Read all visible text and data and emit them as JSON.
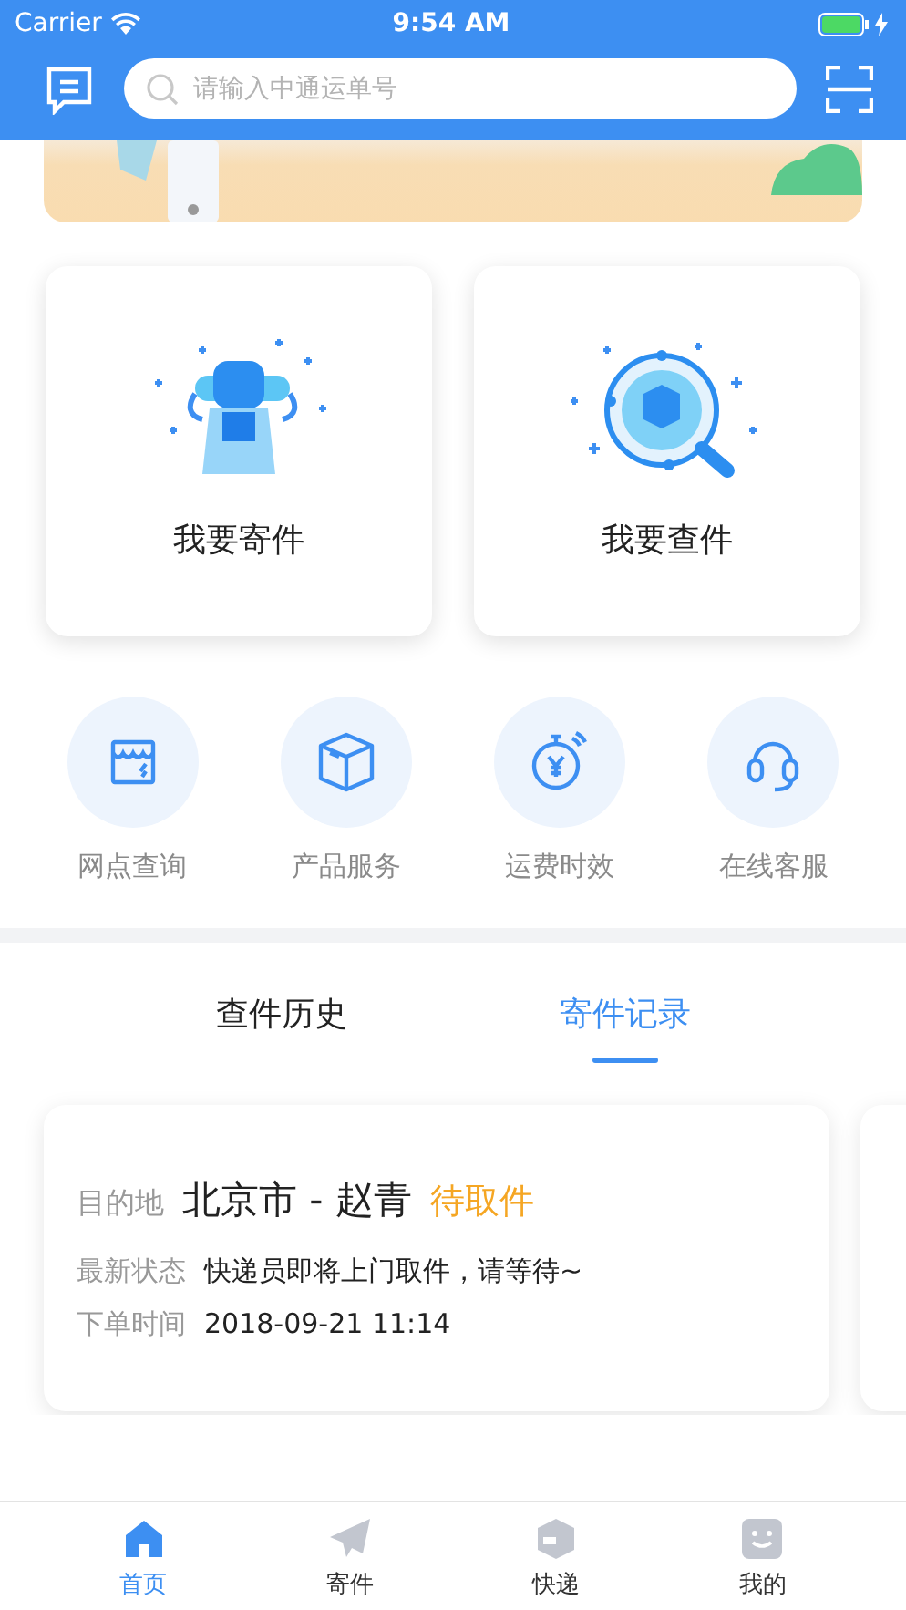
{
  "status_bar": {
    "carrier": "Carrier",
    "time": "9:54 AM"
  },
  "search": {
    "placeholder": "请输入中通运单号"
  },
  "actions": [
    {
      "label": "我要寄件",
      "kind": "send"
    },
    {
      "label": "我要查件",
      "kind": "track"
    }
  ],
  "services": [
    {
      "label": "网点查询",
      "kind": "store"
    },
    {
      "label": "产品服务",
      "kind": "box"
    },
    {
      "label": "运费时效",
      "kind": "timer"
    },
    {
      "label": "在线客服",
      "kind": "headset"
    }
  ],
  "tabs": [
    {
      "label": "查件历史",
      "selected": false
    },
    {
      "label": "寄件记录",
      "selected": true
    }
  ],
  "records": [
    {
      "dest_label": "目的地",
      "dest": "北京市 - 赵青",
      "status": "待取件",
      "state_label": "最新状态",
      "state": "快递员即将上门取件，请等待~",
      "time_label": "下单时间",
      "time": "2018-09-21 11:14"
    }
  ],
  "nav": [
    {
      "label": "首页",
      "kind": "home",
      "selected": true
    },
    {
      "label": "寄件",
      "kind": "plane",
      "selected": false
    },
    {
      "label": "快递",
      "kind": "parcel",
      "selected": false
    },
    {
      "label": "我的",
      "kind": "face",
      "selected": false
    }
  ]
}
